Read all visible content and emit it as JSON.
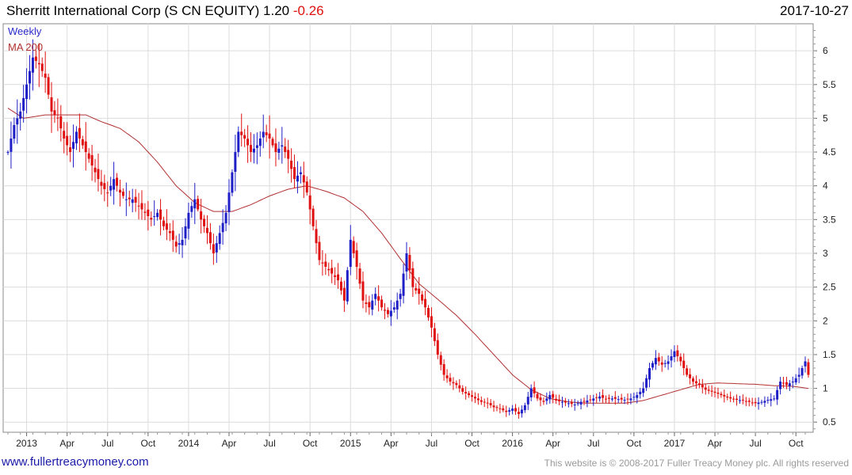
{
  "header": {
    "title": "Sherritt International Corp (S CN EQUITY) 1.20",
    "change": "-0.26",
    "date": "2017-10-27"
  },
  "footer": {
    "site": "www.fullertreacymoney.com",
    "copyright": "This website is © 2008-2017 Fuller Treacy Money plc. All rights reserved"
  },
  "colors": {
    "up": "#1f1fc8",
    "down": "#e01010",
    "ma": "#b03030",
    "grid": "#dcdcdc"
  },
  "chart_data": {
    "type": "line",
    "legend": [
      "Weekly",
      "MA 200"
    ],
    "legend_position": "top-left",
    "grid": true,
    "ylim": [
      0.35,
      6.4
    ],
    "y_ticks": [
      0.5,
      1,
      1.5,
      2,
      2.5,
      3,
      3.5,
      4,
      4.5,
      5,
      5.5,
      6
    ],
    "x_ticks": [
      {
        "label": "2013",
        "week": 6
      },
      {
        "label": "Apr",
        "week": 19
      },
      {
        "label": "Jul",
        "week": 32
      },
      {
        "label": "Oct",
        "week": 45
      },
      {
        "label": "2014",
        "week": 58
      },
      {
        "label": "Apr",
        "week": 71
      },
      {
        "label": "Jul",
        "week": 84
      },
      {
        "label": "Oct",
        "week": 97
      },
      {
        "label": "2015",
        "week": 110
      },
      {
        "label": "Apr",
        "week": 123
      },
      {
        "label": "Jul",
        "week": 136
      },
      {
        "label": "Oct",
        "week": 149
      },
      {
        "label": "2016",
        "week": 162
      },
      {
        "label": "Apr",
        "week": 175
      },
      {
        "label": "Jul",
        "week": 188
      },
      {
        "label": "Oct",
        "week": 201
      },
      {
        "label": "2017",
        "week": 214
      },
      {
        "label": "Apr",
        "week": 227
      },
      {
        "label": "Jul",
        "week": 240
      },
      {
        "label": "Oct",
        "week": 253
      }
    ],
    "x_range_weeks": [
      0,
      256
    ],
    "price_anchors": [
      [
        0,
        4.5
      ],
      [
        2,
        4.9
      ],
      [
        4,
        5.1
      ],
      [
        6,
        5.5
      ],
      [
        8,
        5.9
      ],
      [
        10,
        5.8
      ],
      [
        12,
        5.6
      ],
      [
        14,
        5.1
      ],
      [
        16,
        5.0
      ],
      [
        18,
        4.7
      ],
      [
        20,
        4.5
      ],
      [
        22,
        4.8
      ],
      [
        24,
        4.6
      ],
      [
        26,
        4.4
      ],
      [
        28,
        4.2
      ],
      [
        30,
        4.0
      ],
      [
        32,
        3.9
      ],
      [
        34,
        4.1
      ],
      [
        36,
        3.9
      ],
      [
        38,
        3.8
      ],
      [
        40,
        3.8
      ],
      [
        42,
        3.7
      ],
      [
        44,
        3.6
      ],
      [
        46,
        3.5
      ],
      [
        48,
        3.6
      ],
      [
        50,
        3.4
      ],
      [
        52,
        3.3
      ],
      [
        54,
        3.1
      ],
      [
        56,
        3.2
      ],
      [
        58,
        3.6
      ],
      [
        60,
        3.8
      ],
      [
        62,
        3.5
      ],
      [
        64,
        3.3
      ],
      [
        66,
        3.0
      ],
      [
        68,
        3.3
      ],
      [
        70,
        3.6
      ],
      [
        72,
        4.2
      ],
      [
        74,
        4.8
      ],
      [
        76,
        4.7
      ],
      [
        78,
        4.5
      ],
      [
        80,
        4.6
      ],
      [
        82,
        4.8
      ],
      [
        84,
        4.7
      ],
      [
        86,
        4.5
      ],
      [
        88,
        4.6
      ],
      [
        90,
        4.4
      ],
      [
        92,
        4.1
      ],
      [
        94,
        4.2
      ],
      [
        96,
        3.9
      ],
      [
        98,
        3.4
      ],
      [
        100,
        2.9
      ],
      [
        102,
        2.8
      ],
      [
        104,
        2.7
      ],
      [
        106,
        2.6
      ],
      [
        108,
        2.3
      ],
      [
        110,
        3.2
      ],
      [
        112,
        2.8
      ],
      [
        114,
        2.3
      ],
      [
        116,
        2.2
      ],
      [
        118,
        2.4
      ],
      [
        120,
        2.2
      ],
      [
        122,
        2.1
      ],
      [
        124,
        2.2
      ],
      [
        126,
        2.4
      ],
      [
        128,
        3.0
      ],
      [
        130,
        2.5
      ],
      [
        132,
        2.4
      ],
      [
        134,
        2.2
      ],
      [
        136,
        1.9
      ],
      [
        138,
        1.5
      ],
      [
        140,
        1.2
      ],
      [
        142,
        1.1
      ],
      [
        144,
        1.05
      ],
      [
        146,
        0.95
      ],
      [
        148,
        0.9
      ],
      [
        150,
        0.85
      ],
      [
        152,
        0.8
      ],
      [
        154,
        0.78
      ],
      [
        156,
        0.72
      ],
      [
        158,
        0.7
      ],
      [
        160,
        0.65
      ],
      [
        162,
        0.7
      ],
      [
        164,
        0.62
      ],
      [
        166,
        0.75
      ],
      [
        168,
        1.0
      ],
      [
        170,
        0.85
      ],
      [
        172,
        0.8
      ],
      [
        174,
        0.9
      ],
      [
        176,
        0.82
      ],
      [
        178,
        0.8
      ],
      [
        180,
        0.78
      ],
      [
        182,
        0.76
      ],
      [
        184,
        0.8
      ],
      [
        186,
        0.82
      ],
      [
        188,
        0.85
      ],
      [
        190,
        0.88
      ],
      [
        192,
        0.84
      ],
      [
        194,
        0.85
      ],
      [
        196,
        0.84
      ],
      [
        198,
        0.83
      ],
      [
        200,
        0.85
      ],
      [
        202,
        0.9
      ],
      [
        204,
        1.0
      ],
      [
        206,
        1.3
      ],
      [
        208,
        1.45
      ],
      [
        210,
        1.35
      ],
      [
        212,
        1.4
      ],
      [
        214,
        1.55
      ],
      [
        216,
        1.4
      ],
      [
        218,
        1.2
      ],
      [
        220,
        1.1
      ],
      [
        222,
        1.05
      ],
      [
        224,
        0.98
      ],
      [
        226,
        0.95
      ],
      [
        228,
        0.92
      ],
      [
        230,
        0.88
      ],
      [
        232,
        0.85
      ],
      [
        234,
        0.83
      ],
      [
        236,
        0.82
      ],
      [
        238,
        0.8
      ],
      [
        240,
        0.78
      ],
      [
        242,
        0.8
      ],
      [
        244,
        0.83
      ],
      [
        246,
        0.85
      ],
      [
        248,
        1.1
      ],
      [
        250,
        1.05
      ],
      [
        252,
        1.1
      ],
      [
        254,
        1.2
      ],
      [
        256,
        1.4
      ],
      [
        257,
        1.2
      ]
    ],
    "ma200_anchors": [
      [
        0,
        5.15
      ],
      [
        5,
        5.0
      ],
      [
        12,
        5.05
      ],
      [
        18,
        5.05
      ],
      [
        25,
        5.05
      ],
      [
        30,
        4.95
      ],
      [
        36,
        4.85
      ],
      [
        42,
        4.65
      ],
      [
        48,
        4.35
      ],
      [
        54,
        4.0
      ],
      [
        60,
        3.75
      ],
      [
        66,
        3.62
      ],
      [
        72,
        3.62
      ],
      [
        78,
        3.72
      ],
      [
        84,
        3.85
      ],
      [
        90,
        3.95
      ],
      [
        96,
        4.0
      ],
      [
        102,
        3.92
      ],
      [
        108,
        3.82
      ],
      [
        114,
        3.62
      ],
      [
        120,
        3.3
      ],
      [
        126,
        2.92
      ],
      [
        132,
        2.55
      ],
      [
        138,
        2.32
      ],
      [
        144,
        2.08
      ],
      [
        150,
        1.8
      ],
      [
        156,
        1.5
      ],
      [
        162,
        1.2
      ],
      [
        168,
        0.98
      ],
      [
        174,
        0.85
      ],
      [
        180,
        0.8
      ],
      [
        186,
        0.78
      ],
      [
        192,
        0.78
      ],
      [
        198,
        0.78
      ],
      [
        204,
        0.82
      ],
      [
        210,
        0.9
      ],
      [
        216,
        0.98
      ],
      [
        222,
        1.06
      ],
      [
        228,
        1.08
      ],
      [
        234,
        1.07
      ],
      [
        240,
        1.06
      ],
      [
        246,
        1.04
      ],
      [
        252,
        1.03
      ],
      [
        257,
        1.0
      ]
    ],
    "last_close": 1.2
  }
}
